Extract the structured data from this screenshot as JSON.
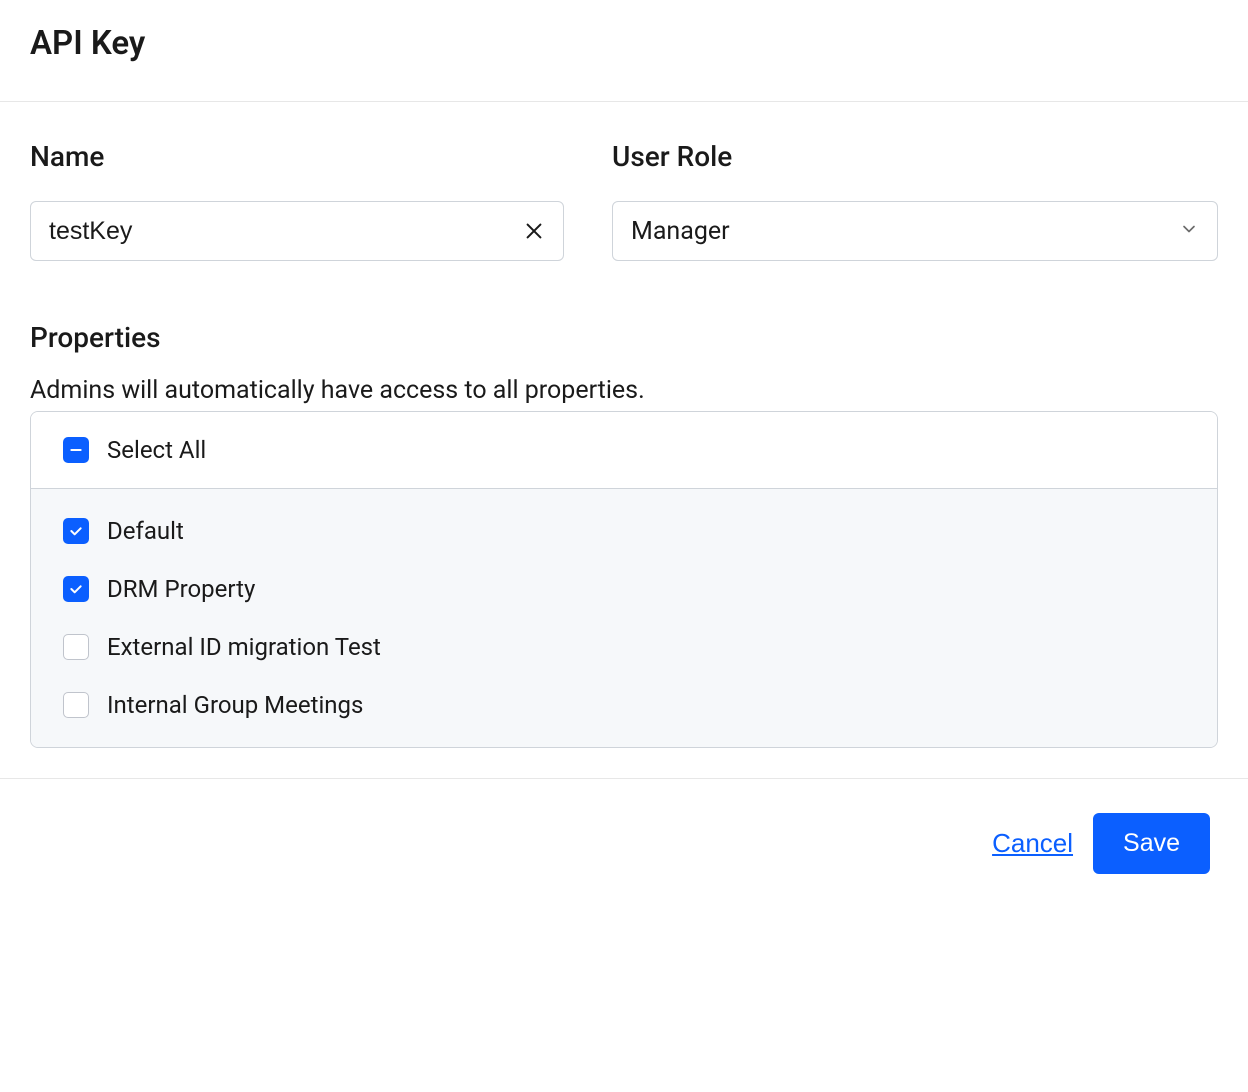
{
  "header": {
    "title": "API Key"
  },
  "name_field": {
    "label": "Name",
    "value": "testKey"
  },
  "role_field": {
    "label": "User Role",
    "selected": "Manager"
  },
  "properties": {
    "heading": "Properties",
    "note": "Admins will automatically have access to all properties.",
    "select_all_label": "Select All",
    "select_all_state": "indeterminate",
    "items": [
      {
        "label": "Default",
        "checked": true
      },
      {
        "label": "DRM Property",
        "checked": true
      },
      {
        "label": "External ID migration Test",
        "checked": false
      },
      {
        "label": "Internal Group Meetings",
        "checked": false
      }
    ]
  },
  "footer": {
    "cancel_label": "Cancel",
    "save_label": "Save"
  },
  "colors": {
    "primary": "#0b5fff"
  }
}
